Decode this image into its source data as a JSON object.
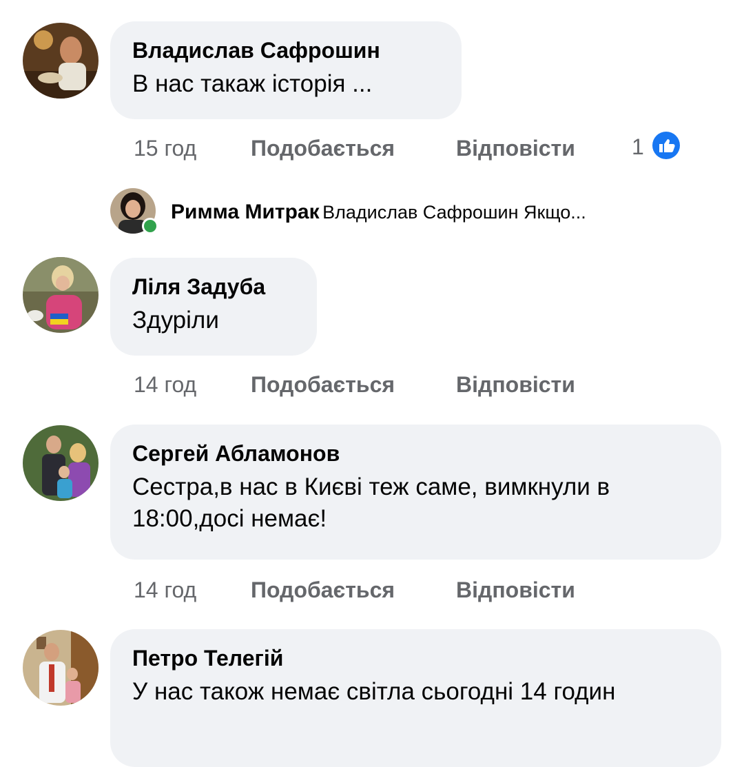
{
  "comments": [
    {
      "author": "Владислав Сафрошин",
      "text": "В нас такаж історія ...",
      "time": "15 год",
      "like_label": "Подобається",
      "reply_label": "Відповісти",
      "reactions": "1",
      "reaction_icon": "like-icon",
      "reply_preview": {
        "author": "Римма Митрак",
        "text": "Владислав Сафрошин Якщо..."
      }
    },
    {
      "author": "Ліля Задуба",
      "text": "Здуріли",
      "time": "14 год",
      "like_label": "Подобається",
      "reply_label": "Відповісти"
    },
    {
      "author": "Сергей Абламонов",
      "text": "Сестра,в нас в Києві теж саме, вимкнули в 18:00,досі немає!",
      "time": "14 год",
      "like_label": "Подобається",
      "reply_label": "Відповісти"
    },
    {
      "author": "Петро Телегій",
      "text": "У нас також немає світла сьогодні 14 годин"
    }
  ],
  "colors": {
    "bubble": "#f0f2f5",
    "meta_text": "#65676b",
    "like_blue": "#1877f2",
    "online_green": "#31a24c"
  }
}
